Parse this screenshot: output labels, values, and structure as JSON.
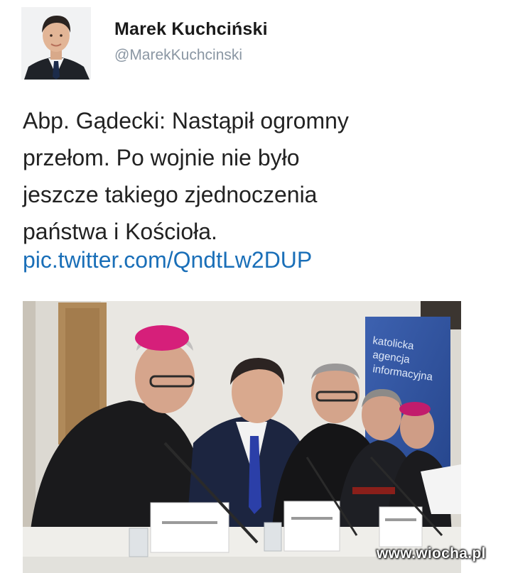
{
  "author": {
    "name": "Marek Kuchciński",
    "handle": "@MarekKuchcinski"
  },
  "tweet": {
    "text_lines": [
      "Abp. Gądecki: Nastąpił ogromny",
      "przełom. Po wojnie nie było",
      "jeszcze takiego zjednoczenia",
      "państwa i Kościoła."
    ],
    "link": "pic.twitter.com/QndtLw2DUP"
  },
  "photo": {
    "banner_text": [
      "katolicka",
      "agencja",
      "informacyjna"
    ],
    "icon": "press-conference-photo"
  },
  "watermark": "www.wiocha.pl",
  "colors": {
    "link": "#1a6fb8",
    "handle": "#8a96a3",
    "banner": "#2d4f9c"
  }
}
